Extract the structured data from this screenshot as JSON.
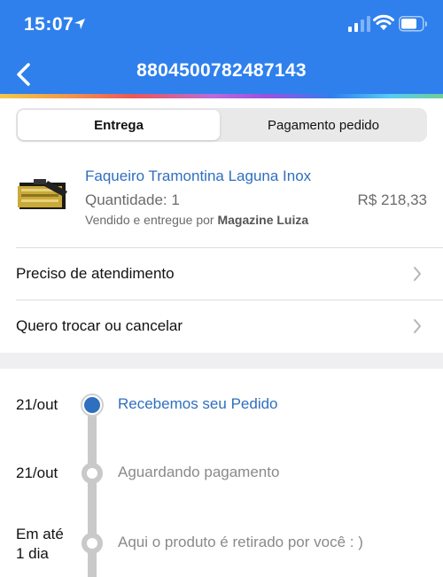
{
  "status_bar": {
    "time": "15:07"
  },
  "header": {
    "title": "8804500782487143"
  },
  "tabs": [
    {
      "label": "Entrega",
      "active": true
    },
    {
      "label": "Pagamento pedido",
      "active": false
    }
  ],
  "product": {
    "name": "Faqueiro Tramontina Laguna Inox",
    "quantity": "Quantidade: 1",
    "price": "R$ 218,33",
    "seller_prefix": "Vendido e entregue por ",
    "seller_name": "Magazine Luiza"
  },
  "menu": [
    {
      "label": "Preciso de atendimento",
      "icon": "chevron-right-icon"
    },
    {
      "label": "Quero trocar ou cancelar",
      "icon": "chevron-right-icon"
    }
  ],
  "timeline": [
    {
      "date": "21/out",
      "text": "Recebemos seu Pedido",
      "active": true
    },
    {
      "date": "21/out",
      "text": "Aguardando pagamento",
      "active": false
    },
    {
      "date": "Em até\n1 dia",
      "text": "Aqui o produto é retirado por você : )",
      "active": false
    }
  ],
  "colors": {
    "accent": "#2f80ed",
    "link": "#2f6fbf"
  }
}
